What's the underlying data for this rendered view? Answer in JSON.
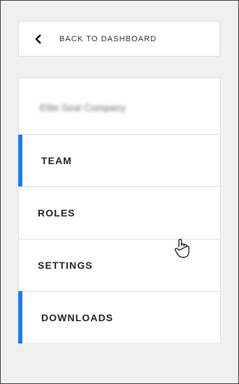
{
  "back": {
    "label": "BACK TO DASHBOARD",
    "icon": "chevron-left-icon"
  },
  "company": {
    "name": "Elite Seal Company"
  },
  "menu": {
    "items": [
      {
        "label": "TEAM",
        "active": true
      },
      {
        "label": "ROLES",
        "active": false
      },
      {
        "label": "SETTINGS",
        "active": false
      },
      {
        "label": "DOWNLOADS",
        "active": true
      }
    ]
  },
  "colors": {
    "accent": "#1f7ae8",
    "panel_bg": "#f0f0f0",
    "card_border": "#dedede"
  },
  "cursor": {
    "icon": "hand-pointer-icon"
  }
}
